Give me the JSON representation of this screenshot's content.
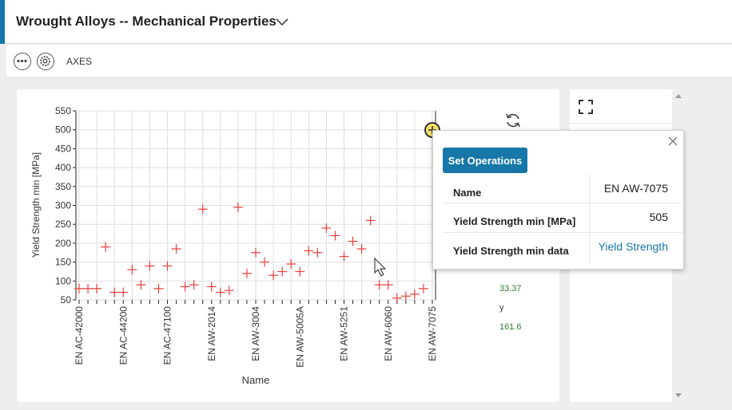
{
  "header": {
    "title": "Wrought Alloys -- Mechanical Properties"
  },
  "toolbar": {
    "axes_label": "AXES"
  },
  "popup": {
    "set_operations": "Set Operations",
    "rows": [
      {
        "key": "Name",
        "value": "EN AW-7075"
      },
      {
        "key": "Yield Strength min [MPa]",
        "value": "505"
      },
      {
        "key": "Yield Strength min data",
        "value": "Yield Strength"
      }
    ]
  },
  "stats": {
    "x_value": "33.37",
    "y_label": "y",
    "y_value": "161.6"
  },
  "colors": {
    "accent": "#1677a8",
    "marker": "#e8403c",
    "stat_value": "#2e7d32"
  },
  "chart_data": {
    "type": "scatter",
    "xlabel": "Name",
    "ylabel": "Yield Strength min [MPa]",
    "ylim": [
      50,
      550
    ],
    "yticks": [
      50,
      100,
      150,
      200,
      250,
      300,
      350,
      400,
      450,
      500,
      550
    ],
    "xtick_labels": [
      "EN AC-42000",
      "EN AC-44200",
      "EN AC-47100",
      "EN AW-2014",
      "EN AW-3004",
      "EN AW-5005A",
      "EN AW-5251",
      "EN AW-6060",
      "EN AW-7075"
    ],
    "n_categories": 41,
    "grid": true,
    "series": [
      {
        "points": [
          [
            0,
            80
          ],
          [
            1,
            80
          ],
          [
            2,
            80
          ],
          [
            3,
            190
          ],
          [
            4,
            70
          ],
          [
            5,
            70
          ],
          [
            6,
            130
          ],
          [
            7,
            90
          ],
          [
            8,
            140
          ],
          [
            9,
            80
          ],
          [
            10,
            140
          ],
          [
            11,
            185
          ],
          [
            12,
            85
          ],
          [
            13,
            90
          ],
          [
            14,
            290
          ],
          [
            15,
            85
          ],
          [
            16,
            70
          ],
          [
            17,
            75
          ],
          [
            18,
            295
          ],
          [
            19,
            120
          ],
          [
            20,
            175
          ],
          [
            21,
            150
          ],
          [
            22,
            115
          ],
          [
            23,
            125
          ],
          [
            24,
            145
          ],
          [
            25,
            125
          ],
          [
            26,
            180
          ],
          [
            27,
            175
          ],
          [
            28,
            240
          ],
          [
            29,
            220
          ],
          [
            30,
            165
          ],
          [
            31,
            205
          ],
          [
            32,
            185
          ],
          [
            33,
            260
          ],
          [
            34,
            90
          ],
          [
            35,
            90
          ],
          [
            36,
            55
          ],
          [
            37,
            60
          ],
          [
            38,
            65
          ],
          [
            39,
            80
          ],
          [
            40,
            505
          ]
        ]
      }
    ]
  }
}
